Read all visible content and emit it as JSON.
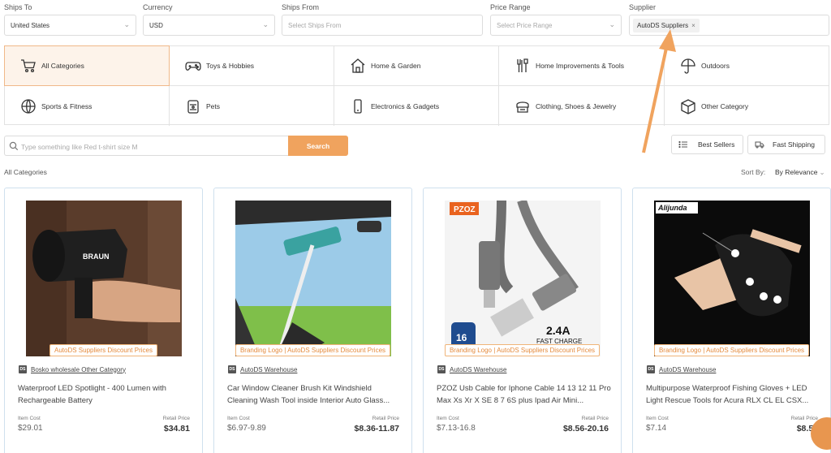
{
  "filters": {
    "ships_to": {
      "label": "Ships To",
      "value": "United States"
    },
    "currency": {
      "label": "Currency",
      "value": "USD"
    },
    "ships_from": {
      "label": "Ships From",
      "placeholder": "Select Ships From"
    },
    "price_range": {
      "label": "Price Range",
      "placeholder": "Select Price Range"
    },
    "supplier": {
      "label": "Supplier",
      "chip": "AutoDS Suppliers",
      "chip_remove": "×"
    }
  },
  "categories": [
    {
      "label": "All Categories",
      "icon": "cart-icon",
      "active": true
    },
    {
      "label": "Toys & Hobbies",
      "icon": "gamepad-icon"
    },
    {
      "label": "Home & Garden",
      "icon": "house-icon"
    },
    {
      "label": "Home Improvements & Tools",
      "icon": "tools-icon"
    },
    {
      "label": "Outdoors",
      "icon": "umbrella-icon"
    },
    {
      "label": "Sports & Fitness",
      "icon": "ball-icon"
    },
    {
      "label": "Pets",
      "icon": "pet-food-icon"
    },
    {
      "label": "Electronics & Gadgets",
      "icon": "phone-icon"
    },
    {
      "label": "Clothing, Shoes & Jewelry",
      "icon": "hat-icon"
    },
    {
      "label": "Other Category",
      "icon": "box-icon"
    }
  ],
  "search": {
    "placeholder": "Type something like Red t-shirt size M",
    "button": "Search"
  },
  "quick_filters": {
    "best_sellers": "Best Sellers",
    "fast_shipping": "Fast Shipping"
  },
  "breadcrumb": "All Categories",
  "sort": {
    "label": "Sort By:",
    "value": "By Relevance"
  },
  "item_cost_label": "Item Cost",
  "retail_price_label": "Retail Price",
  "supplier_tag": "DS",
  "products": [
    {
      "badge": "AutoDS Suppliers Discount Prices",
      "supplier": "Bosko wholesale Other Category",
      "title": "Waterproof LED Spotlight - 400 Lumen with Rechargeable Battery",
      "item_cost": "$29.01",
      "retail_price": "$34.81",
      "image_text": "BRAUN"
    },
    {
      "badge": "Branding Logo | AutoDS Suppliers Discount Prices",
      "supplier": "AutoDS Warehouse",
      "title": "Car Window Cleaner Brush Kit Windshield Cleaning Wash Tool inside Interior Auto Glass...",
      "item_cost": "$6.97-9.89",
      "retail_price": "$8.36-11.87"
    },
    {
      "badge": "Branding Logo | AutoDS Suppliers Discount Prices",
      "supplier": "AutoDS Warehouse",
      "title": "PZOZ Usb Cable for Iphone Cable 14 13 12 11 Pro Max Xs Xr X SE 8 7 6S plus Ipad Air Mini...",
      "item_cost": "$7.13-16.8",
      "retail_price": "$8.56-20.16",
      "image_text": {
        "brand": "PZOZ",
        "speed": "2.4A",
        "charge": "FAST CHARGE",
        "model": "16"
      }
    },
    {
      "badge": "Branding Logo | AutoDS Suppliers Discount Prices",
      "supplier": "AutoDS Warehouse",
      "title": "Multipurpose Waterproof Fishing Gloves + LED Light Rescue Tools for Acura RLX CL EL CSX...",
      "item_cost": "$7.14",
      "retail_price": "$8.57",
      "image_text": "Alijunda"
    }
  ],
  "colors": {
    "accent": "#f0a35e",
    "active_bg": "#fdf3ea",
    "card_border": "#cfe0ee",
    "arrow": "#f0a35e"
  }
}
